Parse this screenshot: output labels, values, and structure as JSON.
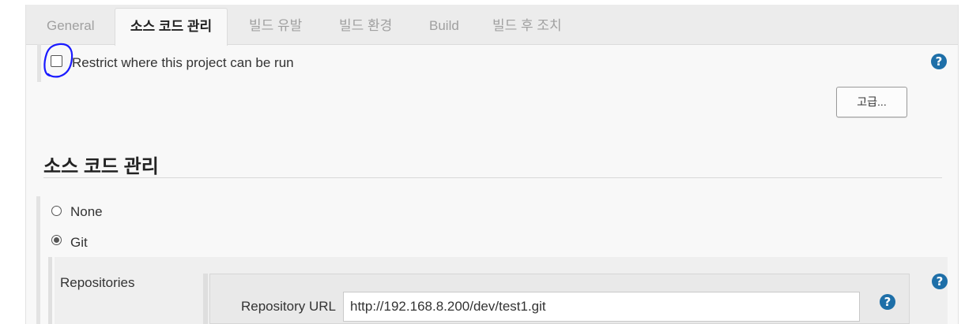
{
  "tabs": [
    {
      "label": "General",
      "active": false
    },
    {
      "label": "소스 코드 관리",
      "active": true
    },
    {
      "label": "빌드 유발",
      "active": false
    },
    {
      "label": "빌드 환경",
      "active": false
    },
    {
      "label": "Build",
      "active": false
    },
    {
      "label": "빌드 후 조치",
      "active": false
    }
  ],
  "restrict": {
    "label": "Restrict where this project can be run",
    "checked": false
  },
  "advanced_button": "고급...",
  "scm": {
    "title": "소스 코드 관리",
    "options": [
      {
        "label": "None",
        "selected": false
      },
      {
        "label": "Git",
        "selected": true
      }
    ],
    "repositories_label": "Repositories",
    "repository_url_label": "Repository URL",
    "repository_url_value": "http://192.168.8.200/dev/test1.git"
  },
  "colors": {
    "help_icon": "#1e6fa8",
    "annotation": "#1a1aff"
  },
  "icons": {
    "help": "?"
  }
}
